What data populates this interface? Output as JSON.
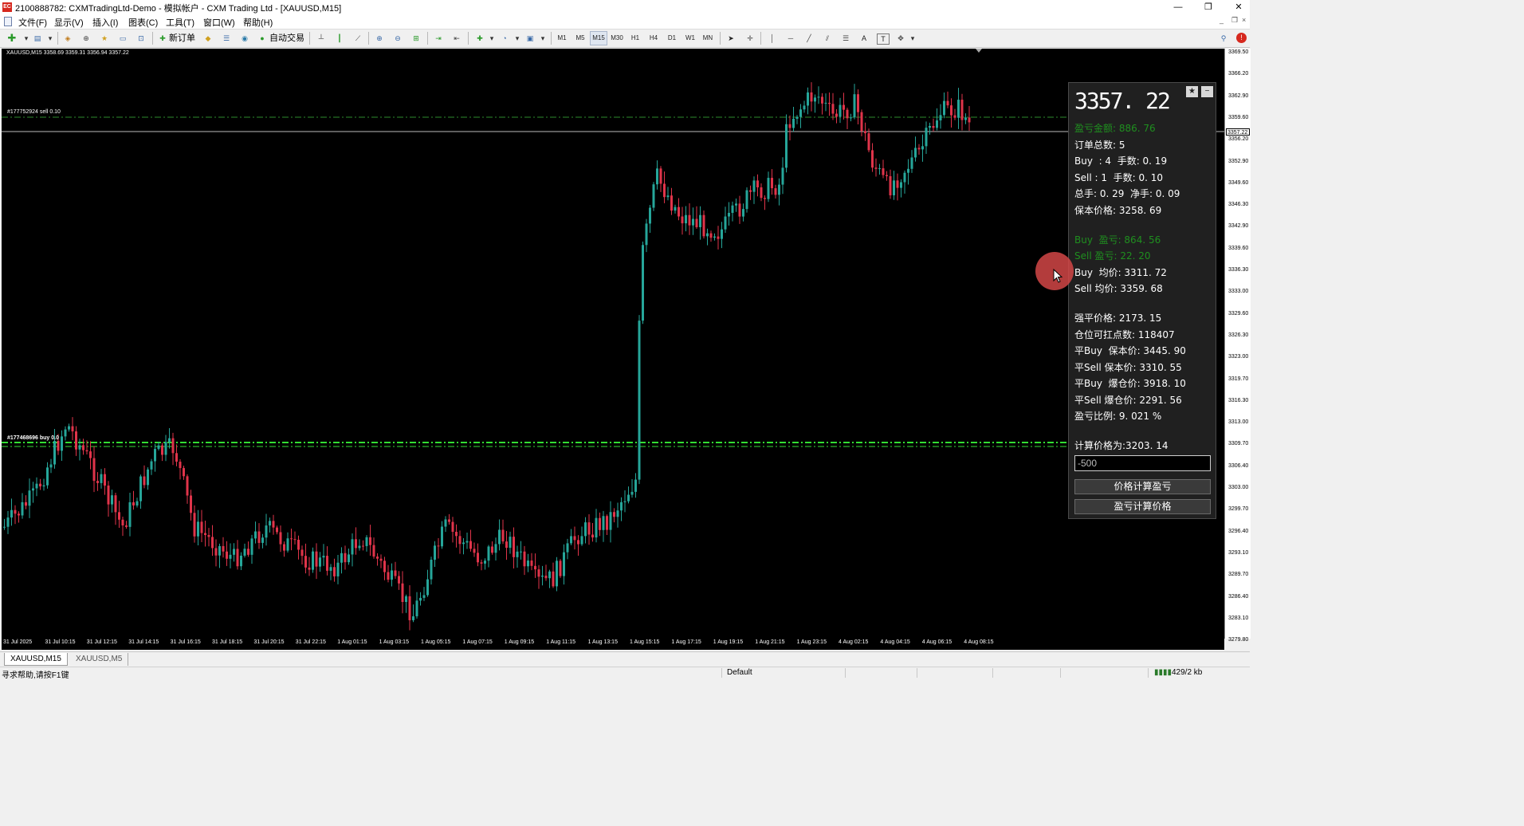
{
  "window": {
    "app_icon": "EC",
    "title": "2100888782: CXMTradingLtd-Demo - 模拟帐户 - CXM Trading Ltd - [XAUUSD,M15]",
    "controls": [
      "—",
      "❐",
      "✕"
    ],
    "mdi_controls": [
      "_",
      "❐",
      "×"
    ]
  },
  "menu": [
    "文件(F)",
    "显示(V)",
    "插入(I)",
    "图表(C)",
    "工具(T)",
    "窗口(W)",
    "帮助(H)"
  ],
  "toolbar": {
    "new_order": "新订单",
    "auto_trading": "自动交易",
    "timeframes": [
      "M1",
      "M5",
      "M15",
      "M30",
      "H1",
      "H4",
      "D1",
      "W1",
      "MN"
    ],
    "active_timeframe": "M15",
    "text_tool": "A",
    "label_tool": "T"
  },
  "chart": {
    "symbol_info": "XAUUSD,M15  3358.69 3359.31 3356.94 3357.22",
    "sell_order_label": "#177752924 sell 0.10",
    "buy_order_label": "#177468696 buy 0.0",
    "current_price_label": "3357.22",
    "price_labels": [
      "3369.50",
      "3366.20",
      "3362.90",
      "3359.60",
      "3356.20",
      "3352.90",
      "3349.60",
      "3346.30",
      "3342.90",
      "3339.60",
      "3336.30",
      "3333.00",
      "3329.60",
      "3326.30",
      "3323.00",
      "3319.70",
      "3316.30",
      "3313.00",
      "3309.70",
      "3306.40",
      "3303.00",
      "3299.70",
      "3296.40",
      "3293.10",
      "3289.70",
      "3286.40",
      "3283.10",
      "3279.80"
    ],
    "time_labels": [
      "31 Jul 2025",
      "31 Jul 10:15",
      "31 Jul 12:15",
      "31 Jul 14:15",
      "31 Jul 16:15",
      "31 Jul 18:15",
      "31 Jul 20:15",
      "31 Jul 22:15",
      "1 Aug 01:15",
      "1 Aug 03:15",
      "1 Aug 05:15",
      "1 Aug 07:15",
      "1 Aug 09:15",
      "1 Aug 11:15",
      "1 Aug 13:15",
      "1 Aug 15:15",
      "1 Aug 17:15",
      "1 Aug 19:15",
      "1 Aug 21:15",
      "1 Aug 23:15",
      "4 Aug 02:15",
      "4 Aug 04:15",
      "4 Aug 06:15",
      "4 Aug 08:15"
    ],
    "colors": {
      "background": "#000000",
      "bull": "#26a69a",
      "bear": "#e0344a",
      "grid": "#ffffff",
      "sell_line": "#2e8b2e",
      "buy_line": "#33dd33"
    }
  },
  "panel": {
    "price": "3357. 22",
    "star_button": "★",
    "minimize_button": "−",
    "lines": [
      {
        "text": "盈亏金额: 886. 76",
        "green": true
      },
      {
        "text": "订单总数: 5",
        "green": false
      },
      {
        "text": "Buy  : 4  手数: 0. 19",
        "green": false
      },
      {
        "text": "Sell : 1  手数: 0. 10",
        "green": false
      },
      {
        "text": "总手: 0. 29  净手: 0. 09",
        "green": false
      },
      {
        "text": "保本价格: 3258. 69",
        "green": false
      },
      {
        "text": "Buy  盈亏: 864. 56",
        "green": true
      },
      {
        "text": "Sell 盈亏: 22. 20",
        "green": true
      },
      {
        "text": "Buy  均价: 3311. 72",
        "green": false
      },
      {
        "text": "Sell 均价: 3359. 68",
        "green": false
      },
      {
        "text": "强平价格: 2173. 15",
        "green": false
      },
      {
        "text": "仓位可扛点数: 118407",
        "green": false
      },
      {
        "text": "平Buy  保本价: 3445. 90",
        "green": false
      },
      {
        "text": "平Sell 保本价: 3310. 55",
        "green": false
      },
      {
        "text": "平Buy  爆仓价: 3918. 10",
        "green": false
      },
      {
        "text": "平Sell 爆仓价: 2291. 56",
        "green": false
      },
      {
        "text": "盈亏比例: 9. 021 %",
        "green": false
      },
      {
        "text": "计算价格为:3203. 14",
        "green": false
      }
    ],
    "input_value": "-500",
    "button_calc_profit": "价格计算盈亏",
    "button_calc_price": "盈亏计算价格"
  },
  "tabs": [
    {
      "label": "XAUUSD,M15",
      "active": true
    },
    {
      "label": "XAUUSD,M5",
      "active": false
    }
  ],
  "status": {
    "help": "寻求帮助,请按F1键",
    "profile": "Default",
    "traffic": "429/2 kb"
  }
}
